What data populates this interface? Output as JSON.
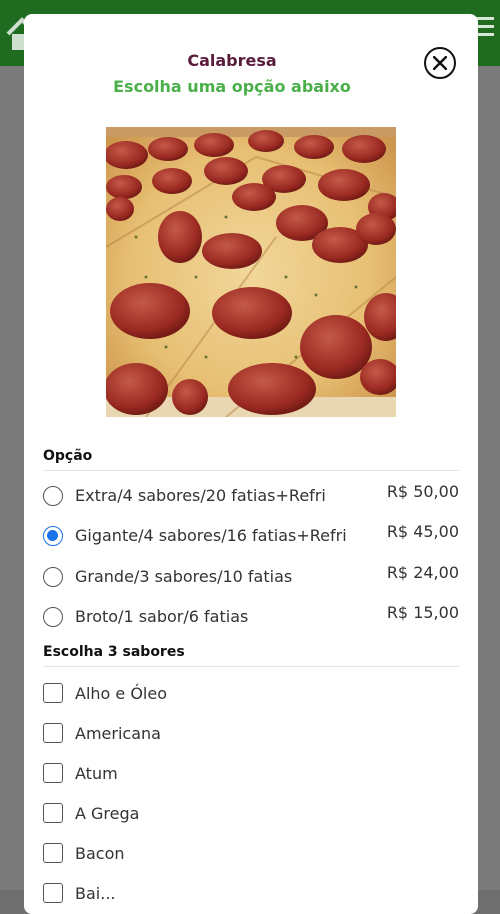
{
  "modal": {
    "title": "Calabresa",
    "subtitle": "Escolha uma opção abaixo"
  },
  "options_section": {
    "header": "Opção",
    "options": [
      {
        "label": "Extra/4 sabores/20 fatias+Refri",
        "price": "R$ 50,00",
        "selected": false
      },
      {
        "label": "Gigante/4 sabores/16 fatias+Refri",
        "price": "R$ 45,00",
        "selected": true
      },
      {
        "label": "Grande/3 sabores/10 fatias",
        "price": "R$ 24,00",
        "selected": false
      },
      {
        "label": "Broto/1 sabor/6 fatias",
        "price": "R$ 15,00",
        "selected": false
      }
    ]
  },
  "flavors_section": {
    "header": "Escolha 3 sabores",
    "flavors": [
      {
        "label": "Alho e Óleo",
        "checked": false
      },
      {
        "label": "Americana",
        "checked": false
      },
      {
        "label": "Atum",
        "checked": false
      },
      {
        "label": "A Grega",
        "checked": false
      },
      {
        "label": "Bacon",
        "checked": false
      },
      {
        "label": "Bai...",
        "checked": false
      }
    ]
  },
  "colors": {
    "topbar": "#1f6b1f",
    "title": "#5a1c3c",
    "subtitle": "#4bb04b",
    "radio_selected": "#1a73e8"
  },
  "icons": {
    "home": "home-icon",
    "menu": "hamburger-menu-icon",
    "close": "close-circle-icon"
  }
}
